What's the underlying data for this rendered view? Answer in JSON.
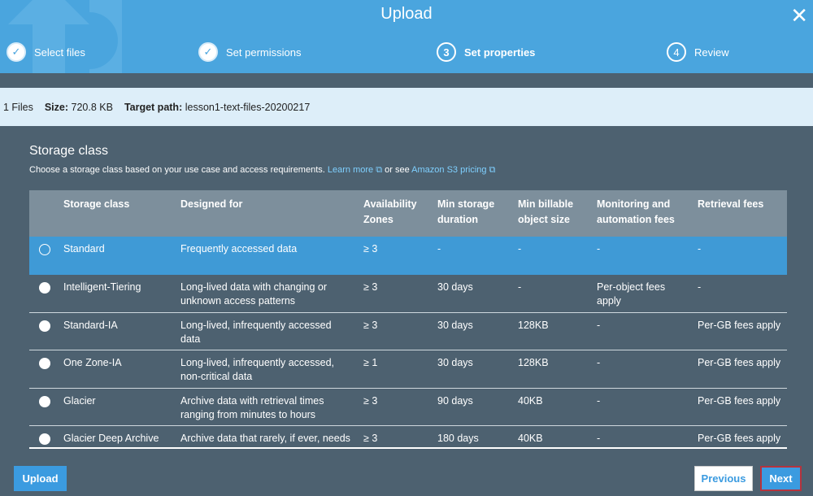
{
  "header": {
    "title": "Upload",
    "steps": [
      {
        "num": "1",
        "label": "Select files",
        "state": "done"
      },
      {
        "num": "2",
        "label": "Set permissions",
        "state": "done"
      },
      {
        "num": "3",
        "label": "Set properties",
        "state": "active"
      },
      {
        "num": "4",
        "label": "Review",
        "state": "pending"
      }
    ]
  },
  "info": {
    "files": "1 Files",
    "size_label": "Size:",
    "size": "720.8 KB",
    "path_label": "Target path:",
    "path": "lesson1-text-files-20200217"
  },
  "section": {
    "title": "Storage class",
    "desc": "Choose a storage class based on your use case and access requirements.",
    "learn_more": "Learn more",
    "or_see": "or see",
    "pricing": "Amazon S3 pricing"
  },
  "table": {
    "headers": [
      "Storage class",
      "Designed for",
      "Availability Zones",
      "Min storage duration",
      "Min billable object size",
      "Monitoring and automation fees",
      "Retrieval fees"
    ],
    "rows": [
      [
        "Standard",
        "Frequently accessed data",
        "≥ 3",
        "-",
        "-",
        "-",
        "-"
      ],
      [
        "Intelligent-Tiering",
        "Long-lived data with changing or unknown access patterns",
        "≥ 3",
        "30 days",
        "-",
        "Per-object fees apply",
        "-"
      ],
      [
        "Standard-IA",
        "Long-lived, infrequently accessed data",
        "≥ 3",
        "30 days",
        "128KB",
        "-",
        "Per-GB fees apply"
      ],
      [
        "One Zone-IA",
        "Long-lived, infrequently accessed, non-critical data",
        "≥ 1",
        "30 days",
        "128KB",
        "-",
        "Per-GB fees apply"
      ],
      [
        "Glacier",
        "Archive data with retrieval times ranging from minutes to hours",
        "≥ 3",
        "90 days",
        "40KB",
        "-",
        "Per-GB fees apply"
      ],
      [
        "Glacier Deep Archive",
        "Archive data that rarely, if ever, needs to be accessed with retrieval times in hours",
        "≥ 3",
        "180 days",
        "40KB",
        "-",
        "Per-GB fees apply"
      ]
    ],
    "selected": 0
  },
  "footer": {
    "upload": "Upload",
    "previous": "Previous",
    "next": "Next"
  }
}
